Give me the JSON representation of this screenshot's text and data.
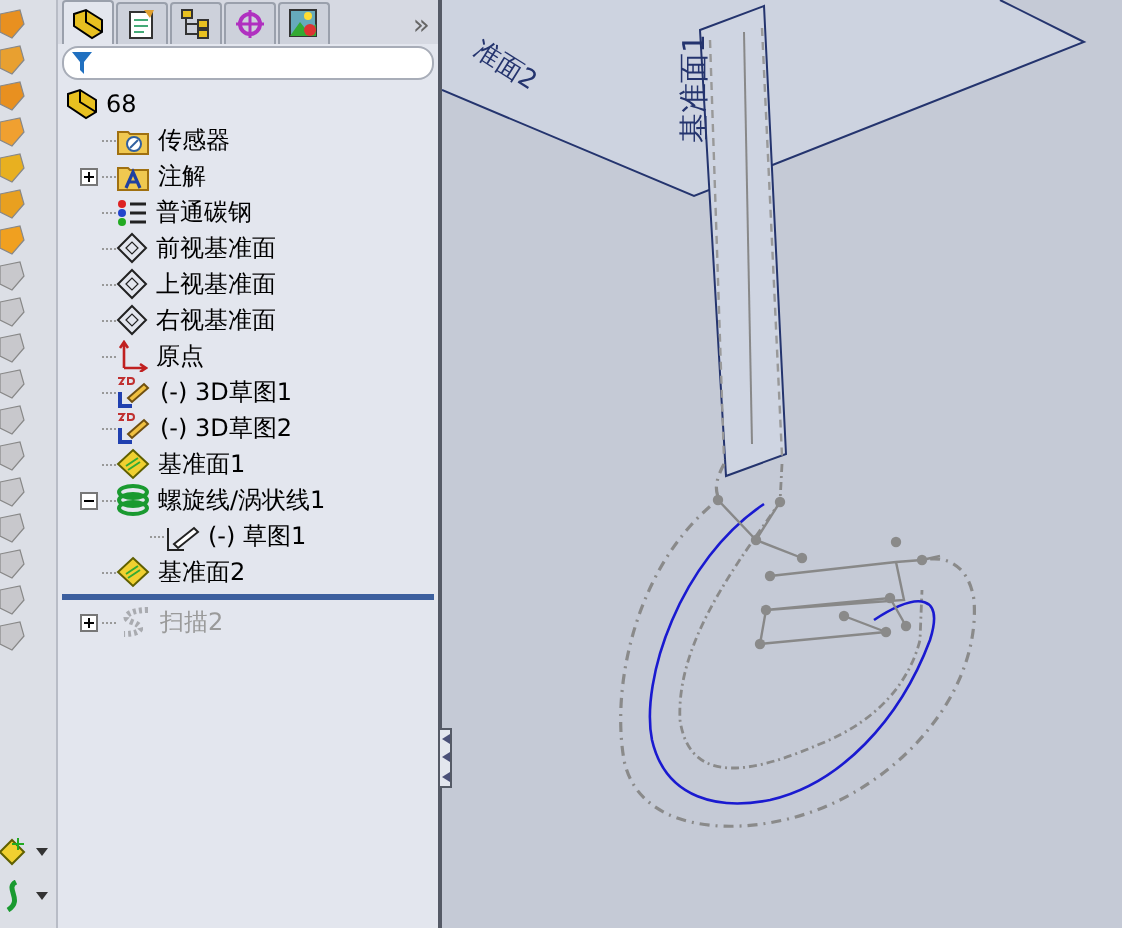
{
  "panel_tabs": [
    {
      "selected": true
    },
    {
      "selected": false
    },
    {
      "selected": false
    },
    {
      "selected": false
    },
    {
      "selected": false
    }
  ],
  "more_tabs": "»",
  "tree": {
    "root": {
      "label": "68"
    },
    "items": [
      {
        "kind": "sensor",
        "label": "传感器",
        "disabled": false
      },
      {
        "kind": "annotation",
        "label": "注解",
        "disabled": false,
        "expanded": false
      },
      {
        "kind": "material",
        "label": "普通碳钢",
        "disabled": false
      },
      {
        "kind": "plane",
        "label": "前视基准面",
        "disabled": false
      },
      {
        "kind": "plane",
        "label": "上视基准面",
        "disabled": false
      },
      {
        "kind": "plane",
        "label": "右视基准面",
        "disabled": false
      },
      {
        "kind": "origin",
        "label": "原点",
        "disabled": false
      },
      {
        "kind": "sketch3d",
        "label": "(-) 3D草图1",
        "disabled": false
      },
      {
        "kind": "sketch3d",
        "label": "(-) 3D草图2",
        "disabled": false
      },
      {
        "kind": "refplane",
        "label": "基准面1",
        "disabled": false
      },
      {
        "kind": "helix",
        "label": "螺旋线/涡状线1",
        "disabled": false,
        "expanded": true,
        "children": [
          {
            "kind": "sketch",
            "label": "(-) 草图1",
            "disabled": false
          }
        ]
      },
      {
        "kind": "refplane",
        "label": "基准面2",
        "disabled": false
      },
      {
        "kind": "rollback"
      },
      {
        "kind": "sweep",
        "label": "扫描2",
        "disabled": true,
        "expanded": false
      }
    ]
  },
  "viewport": {
    "plane_labels": [
      "基准面1",
      "准面2"
    ]
  }
}
